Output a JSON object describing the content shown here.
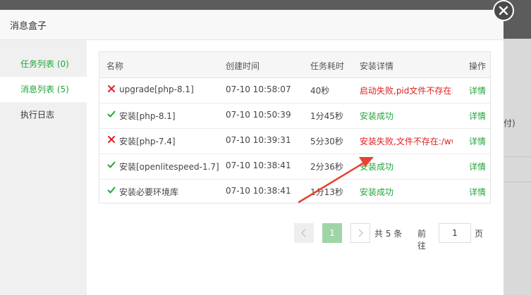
{
  "modal": {
    "title": "消息盒子"
  },
  "background": {
    "fragment": "付)"
  },
  "sidebar": {
    "items": [
      {
        "label": "任务列表 (0)"
      },
      {
        "label": "消息列表 (5)"
      },
      {
        "label": "执行日志"
      }
    ]
  },
  "table": {
    "headers": [
      "名称",
      "创建时间",
      "任务耗时",
      "安装详情",
      "操作"
    ],
    "rows": [
      {
        "status": "fail",
        "name": "upgrade[php-8.1]",
        "time": "07-10 10:58:07",
        "duration": "40秒",
        "detail": "启动失败,pid文件不存在:",
        "action": "详情"
      },
      {
        "status": "success",
        "name": "安装[php-8.1]",
        "time": "07-10 10:50:39",
        "duration": "1分45秒",
        "detail": "安装成功",
        "action": "详情"
      },
      {
        "status": "fail",
        "name": "安装[php-7.4]",
        "time": "07-10 10:39:31",
        "duration": "5分30秒",
        "detail": "安装失败,文件不存在:/ww",
        "action": "详情"
      },
      {
        "status": "success",
        "name": "安装[openlitespeed-1.7]",
        "time": "07-10 10:38:41",
        "duration": "2分36秒",
        "detail": "安装成功",
        "action": "详情"
      },
      {
        "status": "success",
        "name": "安装必要环境库",
        "time": "07-10 10:38:41",
        "duration": "1分13秒",
        "detail": "安装成功",
        "action": "详情"
      }
    ]
  },
  "pagination": {
    "current": "1",
    "total_text": "共 5 条",
    "goto_label": "前往",
    "goto_value": "1",
    "page_suffix": "页"
  },
  "colors": {
    "accent": "#20a53a",
    "error": "#e02020",
    "annotation_arrow": "#e8412c"
  },
  "icons": {
    "fail": "x-icon",
    "success": "check-icon",
    "close": "close-icon"
  }
}
